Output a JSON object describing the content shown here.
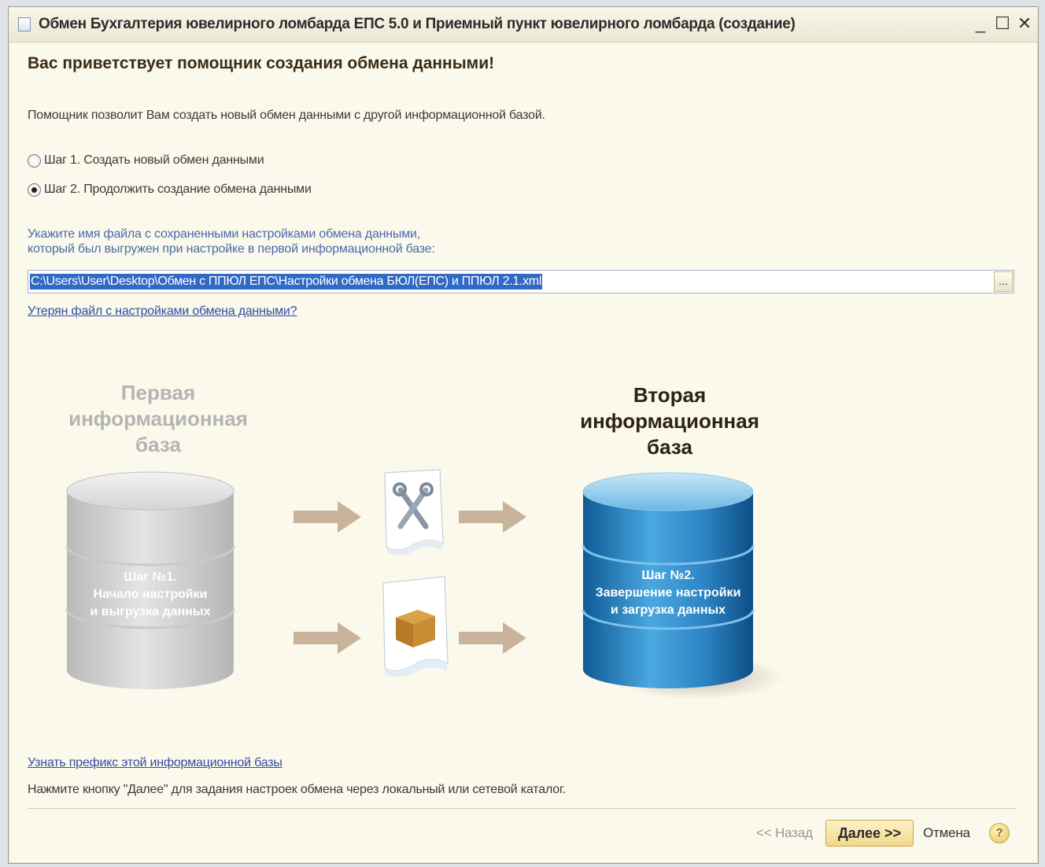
{
  "window": {
    "title": "Обмен Бухгалтерия ювелирного ломбарда ЕПС 5.0 и Приемный пункт ювелирного ломбарда (создание)",
    "minimize": "_",
    "maximize": "☐",
    "close": "✕"
  },
  "heading": "Вас приветствует помощник создания обмена данными!",
  "intro": "Помощник позволит Вам создать новый обмен данными с другой информационной базой.",
  "steps": [
    {
      "label": "Шаг 1. Создать новый обмен данными",
      "selected": false
    },
    {
      "label": "Шаг 2. Продолжить создание обмена данными",
      "selected": true
    }
  ],
  "hint": {
    "line1": "Укажите имя файла с сохраненными настройками обмена данными,",
    "line2": "который был выгружен при настройке в первой информационной базе:"
  },
  "file_path": "C:\\Users\\User\\Desktop\\Обмен с ППЮЛ ЕПС\\Настройки обмена БЮЛ(ЕПС) и ППЮЛ 2.1.xml",
  "browse_label": "...",
  "lost_file_link": "Утерян файл с настройками обмена данными?",
  "diagram": {
    "first_db": {
      "l1": "Первая",
      "l2": "информационная",
      "l3": "база"
    },
    "first_step": {
      "l1": "Шаг №1.",
      "l2": "Начало настройки",
      "l3": "и выгрузка данных"
    },
    "second_db": {
      "l1": "Вторая",
      "l2": "информационная",
      "l3": "база"
    },
    "second_step": {
      "l1": "Шаг №2.",
      "l2": "Завершение настройки",
      "l3": "и загрузка данных"
    }
  },
  "prefix_link": "Узнать префикс этой информационной базы",
  "footer": "Нажмите кнопку \"Далее\" для задания настроек обмена через локальный или сетевой каталог.",
  "buttons": {
    "back": "<< Назад",
    "next": "Далее >>",
    "cancel": "Отмена",
    "help": "?"
  },
  "colors": {
    "background": "#fbf8ec",
    "link": "#2f4fa0",
    "hint": "#4a6ba8",
    "selection": "#3169c6",
    "db_inactive": "#c8c8c8",
    "db_active": "#2f8fd0"
  }
}
